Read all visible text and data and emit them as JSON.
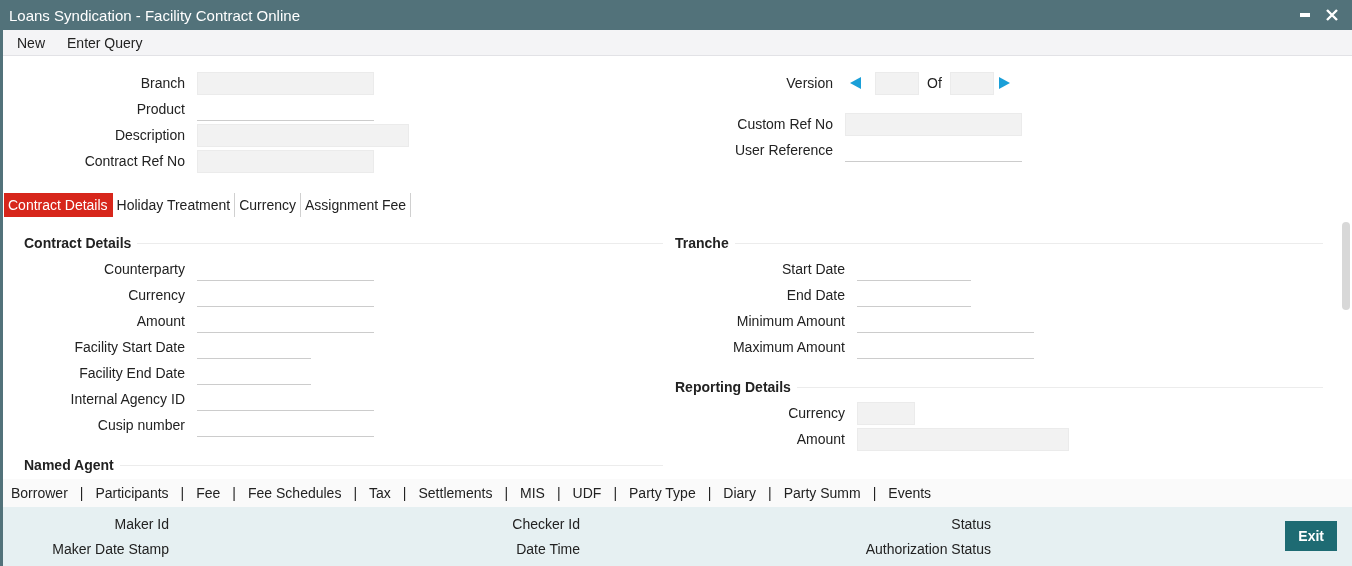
{
  "window": {
    "title": "Loans Syndication - Facility Contract Online"
  },
  "menu": [
    "New",
    "Enter Query"
  ],
  "header_left": [
    {
      "label": "Branch",
      "kind": "readonly"
    },
    {
      "label": "Product",
      "kind": "input"
    },
    {
      "label": "Description",
      "kind": "readonly-wide"
    },
    {
      "label": "Contract Ref No",
      "kind": "readonly"
    }
  ],
  "version": {
    "label": "Version",
    "of": "Of"
  },
  "header_right": [
    {
      "label": "Custom Ref No",
      "kind": "readonly"
    },
    {
      "label": "User Reference",
      "kind": "input"
    }
  ],
  "tabs": [
    {
      "label": "Contract Details",
      "selected": true
    },
    {
      "label": "Holiday Treatment",
      "selected": false
    },
    {
      "label": "Currency",
      "selected": false
    },
    {
      "label": "Assignment Fee",
      "selected": false
    }
  ],
  "sections_left": [
    {
      "title": "Contract Details",
      "fields": [
        {
          "label": "Counterparty",
          "kind": "input"
        },
        {
          "label": "Currency",
          "kind": "input"
        },
        {
          "label": "Amount",
          "kind": "input"
        },
        {
          "label": "Facility Start Date",
          "kind": "date"
        },
        {
          "label": "Facility End Date",
          "kind": "date"
        },
        {
          "label": "Internal Agency ID",
          "kind": "input"
        },
        {
          "label": "Cusip number",
          "kind": "input"
        }
      ]
    },
    {
      "title": "Named Agent"
    }
  ],
  "sections_right": [
    {
      "title": "Tranche",
      "fields": [
        {
          "label": "Start Date",
          "kind": "date"
        },
        {
          "label": "End Date",
          "kind": "date"
        },
        {
          "label": "Minimum Amount",
          "kind": "input"
        },
        {
          "label": "Maximum Amount",
          "kind": "input"
        }
      ]
    },
    {
      "title": "Reporting Details",
      "fields": [
        {
          "label": "Currency",
          "kind": "readonly-short"
        },
        {
          "label": "Amount",
          "kind": "readonly-wide"
        }
      ]
    }
  ],
  "links": [
    "Borrower",
    "|",
    "Participants",
    "|",
    "Fee",
    "|",
    "Fee Schedules",
    "|",
    "Tax",
    "|",
    "Settlements",
    "|",
    "MIS",
    "|",
    "UDF",
    "|",
    "Party Type",
    "|",
    "Diary",
    "|",
    "Party Summ",
    "|",
    "Events"
  ],
  "audit": [
    [
      "Maker Id",
      "Maker Date Stamp"
    ],
    [
      "Checker Id",
      "Date Time"
    ],
    [
      "Status",
      "Authorization Status"
    ]
  ],
  "exit_button": "Exit"
}
